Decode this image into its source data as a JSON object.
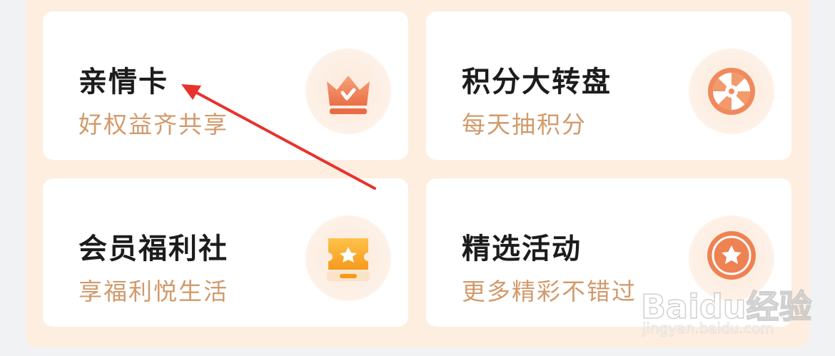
{
  "cards": [
    {
      "title": "亲情卡",
      "subtitle": "好权益齐共享",
      "icon": "crown-icon"
    },
    {
      "title": "积分大转盘",
      "subtitle": "每天抽积分",
      "icon": "wheel-icon"
    },
    {
      "title": "会员福利社",
      "subtitle": "享福利悦生活",
      "icon": "ticket-star-icon"
    },
    {
      "title": "精选活动",
      "subtitle": "更多精彩不错过",
      "icon": "medal-star-icon"
    }
  ],
  "watermark": {
    "logo": "Baidu经验",
    "url": "jingyan.baidu.com"
  },
  "colors": {
    "panel_bg": "#fdeee0",
    "card_bg": "#ffffff",
    "title": "#1c1c1c",
    "subtitle": "#d29a6c",
    "icon_orange": "#f08a5d",
    "annotation_arrow": "#e8322c"
  }
}
